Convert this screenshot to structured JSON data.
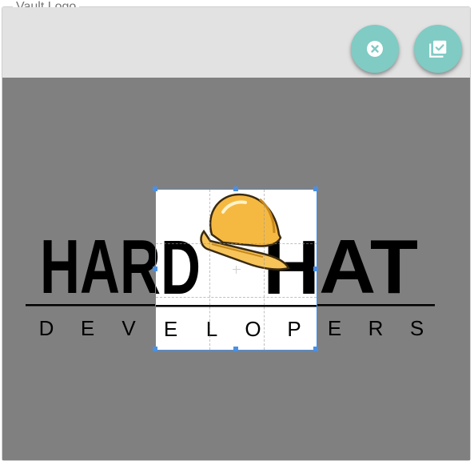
{
  "window": {
    "legend": "Vault Logo"
  },
  "actions": {
    "cancel_icon": "close-circle-icon",
    "confirm_icon": "check-collection-icon",
    "accent": "#80cbc4"
  },
  "logo": {
    "word_left": "HARD",
    "word_right": "HAT",
    "subtitle_letters": [
      "D",
      "E",
      "V",
      "E",
      "L",
      "O",
      "P",
      "E",
      "R",
      "S"
    ],
    "helmet_color": "#f5b942"
  },
  "crop": {
    "border_color": "#4a90e2"
  }
}
